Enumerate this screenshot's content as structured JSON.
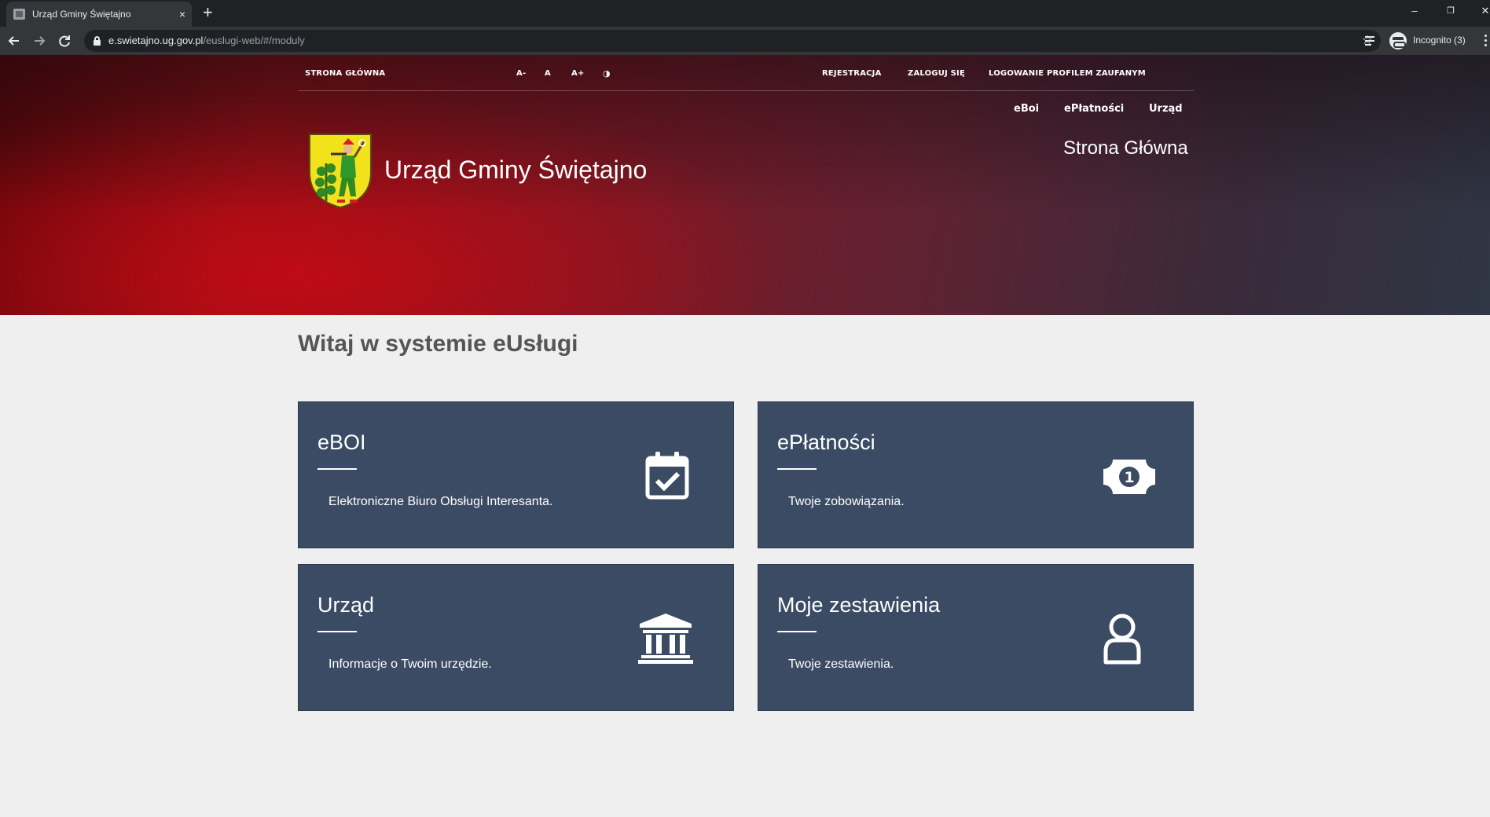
{
  "browser": {
    "tab_title": "Urząd Gminy Świętajno",
    "tab_close": "×",
    "new_tab": "+",
    "url_host": "e.swietajno.ug.gov.pl",
    "url_path": "/euslugi-web/#/moduly",
    "profile_label": "Incognito (3)",
    "window_minimize": "–",
    "window_restore": "❐",
    "window_close": "✕"
  },
  "header": {
    "util_links": {
      "home": "STRONA GŁÓWNA",
      "font_smaller": "A-",
      "font_normal": "A",
      "font_larger": "A+",
      "contrast": "◑",
      "register": "REJESTRACJA",
      "login": "ZALOGUJ SIĘ",
      "trusted_profile": "LOGOWANIE PROFILEM ZAUFANYM"
    },
    "nav": {
      "eboi": "eBoi",
      "eplatnosci": "ePłatności",
      "urzad": "Urząd"
    },
    "site_title": "Urząd Gminy Świętajno",
    "current_page": "Strona Główna"
  },
  "main": {
    "welcome": "Witaj w systemie eUsługi",
    "tiles": [
      {
        "title": "eBOI",
        "description": "Elektroniczne Biuro Obsługi Interesanta.",
        "icon": "calendar-check-icon"
      },
      {
        "title": "ePłatności",
        "description": "Twoje zobowiązania.",
        "icon": "banknote-icon",
        "icon_text": "1"
      },
      {
        "title": "Urząd",
        "description": "Informacje o Twoim urzędzie.",
        "icon": "building-columns-icon"
      },
      {
        "title": "Moje zestawienia",
        "description": "Twoje zestawienia.",
        "icon": "user-icon"
      }
    ]
  },
  "colors": {
    "tile_background": "#3a4b63",
    "page_background": "#efefef",
    "header_red": "#c8101a",
    "header_slate": "#2f3644"
  }
}
